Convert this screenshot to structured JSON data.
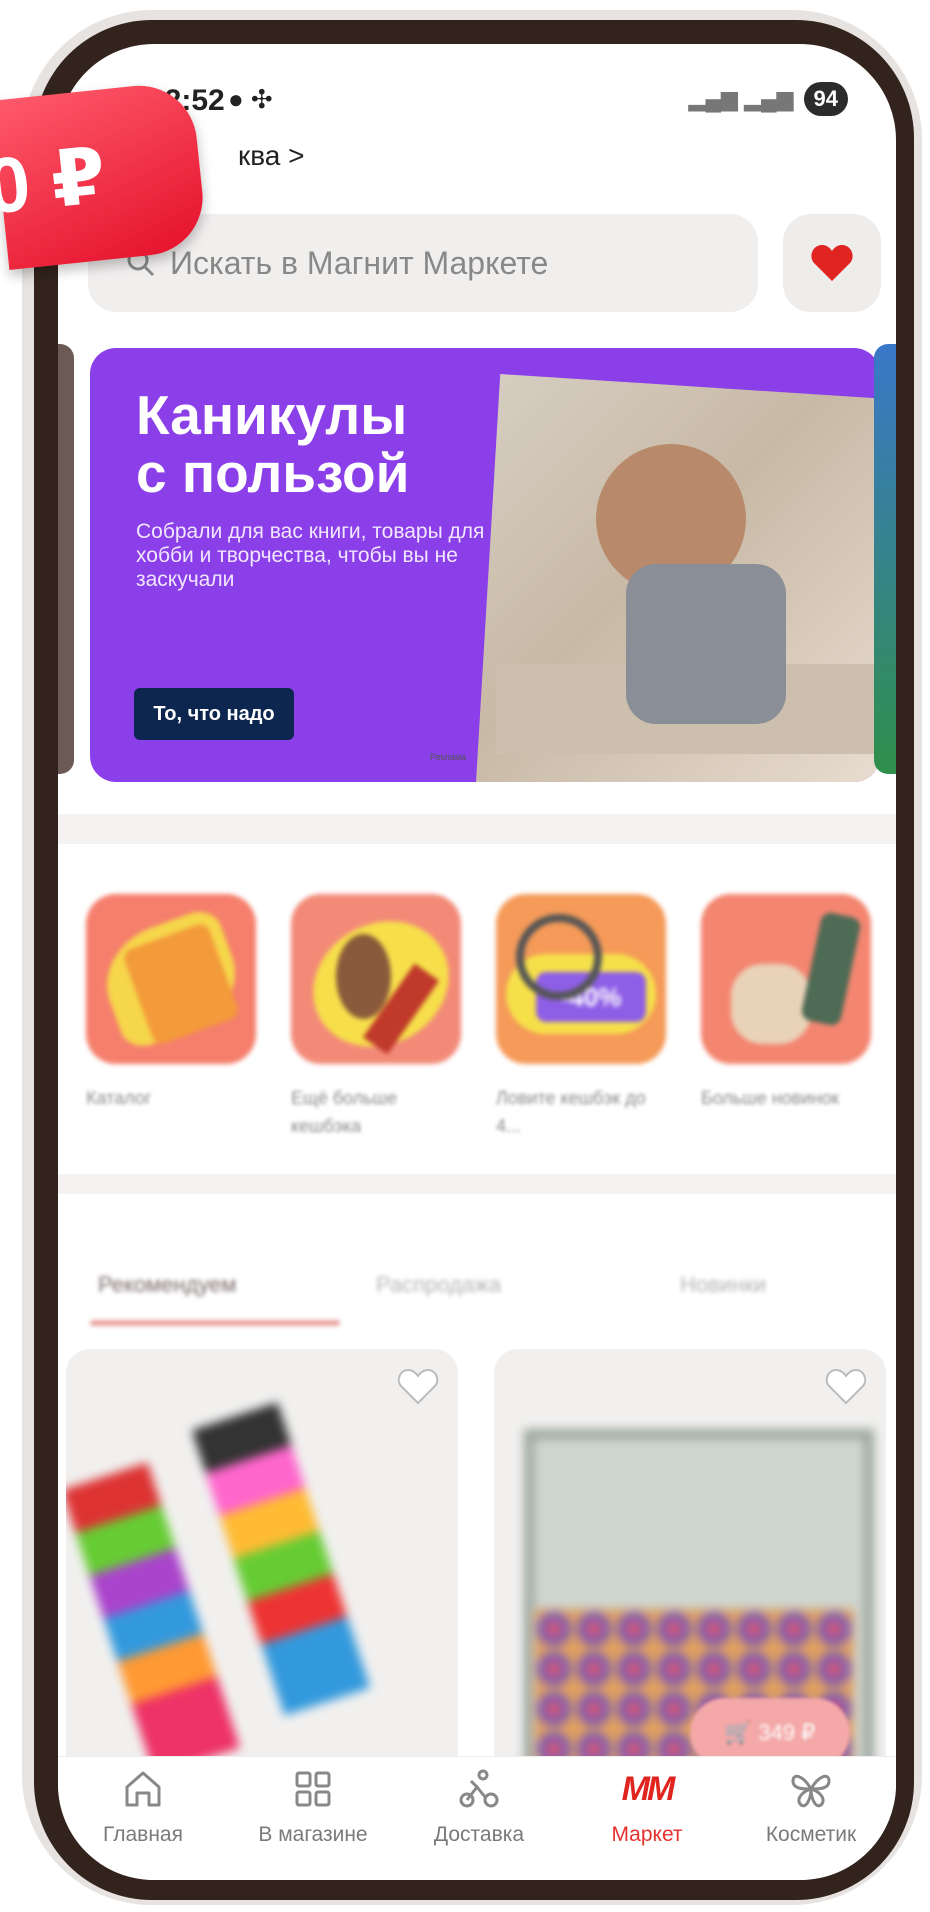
{
  "promo": {
    "price_text": "0 ₽"
  },
  "status_bar": {
    "time": "12:52",
    "left_icons": "● ✣",
    "signal": "▂▄▆ ▂▄▆",
    "battery": "94"
  },
  "location": {
    "label": "ква >"
  },
  "search": {
    "placeholder": "Искать в Магнит Маркете"
  },
  "banner": {
    "title": "Каникулы\nс пользой",
    "subtitle": "Собрали для вас книги, товары для хобби и творчества, чтобы вы не заскучали",
    "button_label": "То, что надо",
    "ad_note": "Реклама"
  },
  "shortcuts": [
    {
      "label": "Каталог"
    },
    {
      "label": "Ещё больше кешбэка"
    },
    {
      "label": "Ловите кешбэк до 4..."
    },
    {
      "label": "Больше новинок"
    }
  ],
  "shortcut_badge": "-40%",
  "tabs": [
    {
      "label": "Рекомендуем",
      "active": true
    },
    {
      "label": "Распродажа",
      "active": false
    },
    {
      "label": "Новинки",
      "active": false
    }
  ],
  "floating_price": "🛒 349 ₽",
  "bottom_nav": [
    {
      "label": "Главная",
      "icon": "home-icon",
      "active": false
    },
    {
      "label": "В магазине",
      "icon": "grid-icon",
      "active": false
    },
    {
      "label": "Доставка",
      "icon": "courier-icon",
      "active": false
    },
    {
      "label": "Маркет",
      "icon": "mm-logo-icon",
      "logo_text": "MM",
      "active": true
    },
    {
      "label": "Косметик",
      "icon": "butterfly-icon",
      "active": false
    }
  ],
  "colors": {
    "accent": "#e5312e",
    "banner": "#8b3fe8",
    "heart": "#e0241f"
  }
}
